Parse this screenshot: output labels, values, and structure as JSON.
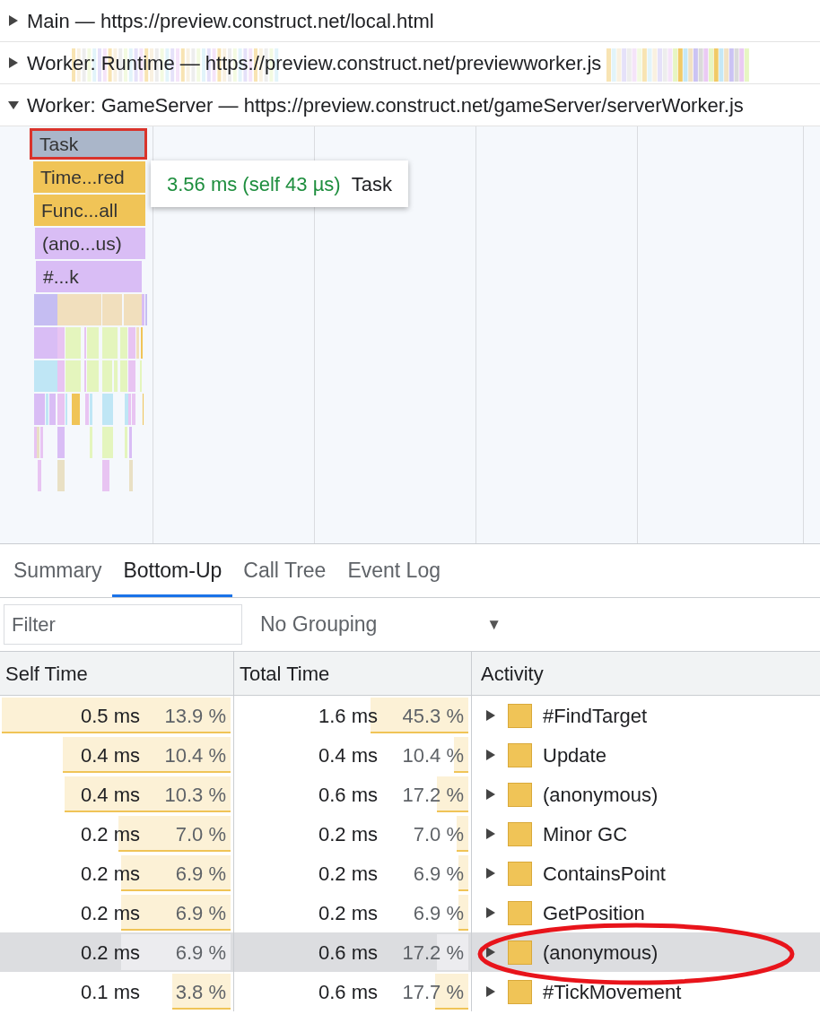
{
  "tracks": [
    {
      "label": "Main — https://preview.construct.net/local.html",
      "expanded": false
    },
    {
      "label": "Worker: Runtime — https://preview.construct.net/previewworker.js",
      "expanded": false
    },
    {
      "label": "Worker: GameServer — https://preview.construct.net/gameServer/serverWorker.js",
      "expanded": true
    }
  ],
  "flame_chart": {
    "entries": [
      {
        "label": "Task",
        "color": "#aab6c9",
        "selected": true
      },
      {
        "label": "Time...red",
        "color": "#f0c457",
        "selected": false
      },
      {
        "label": "Func...all",
        "color": "#f0c457",
        "selected": false
      },
      {
        "label": "(ano...us)",
        "color": "#d9bdf5",
        "selected": false
      },
      {
        "label": "#...k",
        "color": "#d9bdf5",
        "selected": false
      }
    ],
    "tooltip": {
      "time": "3.56 ms (self 43 µs)",
      "name": "Task"
    }
  },
  "tabs": [
    {
      "label": "Summary",
      "selected": false
    },
    {
      "label": "Bottom-Up",
      "selected": true
    },
    {
      "label": "Call Tree",
      "selected": false
    },
    {
      "label": "Event Log",
      "selected": false
    }
  ],
  "filter": {
    "placeholder": "Filter"
  },
  "grouping": {
    "value": "No Grouping",
    "arrow": "▼"
  },
  "table": {
    "columns": [
      "Self Time",
      "Total Time",
      "Activity"
    ],
    "rows": [
      {
        "self": "0.5 ms",
        "self_pct": "13.9 %",
        "self_bar": {
          "level": 1
        },
        "total": "1.6 ms",
        "total_pct": "45.3 %",
        "total_bar": {
          "level": 0.43
        },
        "activity": "#FindTarget",
        "selected": false
      },
      {
        "self": "0.4 ms",
        "self_pct": "10.4 %",
        "self_bar": {
          "level": 0.74
        },
        "total": "0.4 ms",
        "total_pct": "10.4 %",
        "total_bar": {
          "level": 0.08
        },
        "activity": "Update",
        "selected": false
      },
      {
        "self": "0.4 ms",
        "self_pct": "10.3 %",
        "self_bar": {
          "level": 0.73
        },
        "total": "0.6 ms",
        "total_pct": "17.2 %",
        "total_bar": {
          "level": 0.15
        },
        "activity": "(anonymous)",
        "selected": false
      },
      {
        "self": "0.2 ms",
        "self_pct": "7.0 %",
        "self_bar": {
          "level": 0.5
        },
        "total": "0.2 ms",
        "total_pct": "7.0 %",
        "total_bar": {
          "level": 0.07
        },
        "activity": "Minor GC",
        "selected": false
      },
      {
        "self": "0.2 ms",
        "self_pct": "6.9 %",
        "self_bar": {
          "level": 0.49
        },
        "total": "0.2 ms",
        "total_pct": "6.9 %",
        "total_bar": {
          "level": 0.06
        },
        "activity": "ContainsPoint",
        "selected": false
      },
      {
        "self": "0.2 ms",
        "self_pct": "6.9 %",
        "self_bar": {
          "level": 0.49
        },
        "total": "0.2 ms",
        "total_pct": "6.9 %",
        "total_bar": {
          "level": 0.06
        },
        "activity": "GetPosition",
        "selected": false
      },
      {
        "self": "0.2 ms",
        "self_pct": "6.9 %",
        "self_bar": {
          "level": 0.49
        },
        "total": "0.6 ms",
        "total_pct": "17.2 %",
        "total_bar": {
          "level": 0.15
        },
        "activity": "(anonymous)",
        "selected": true
      },
      {
        "self": "0.1 ms",
        "self_pct": "3.8 %",
        "self_bar": {
          "level": 0.27
        },
        "total": "0.6 ms",
        "total_pct": "17.7 %",
        "total_bar": {
          "level": 0.16
        },
        "activity": "#TickMovement",
        "selected": false
      }
    ]
  }
}
